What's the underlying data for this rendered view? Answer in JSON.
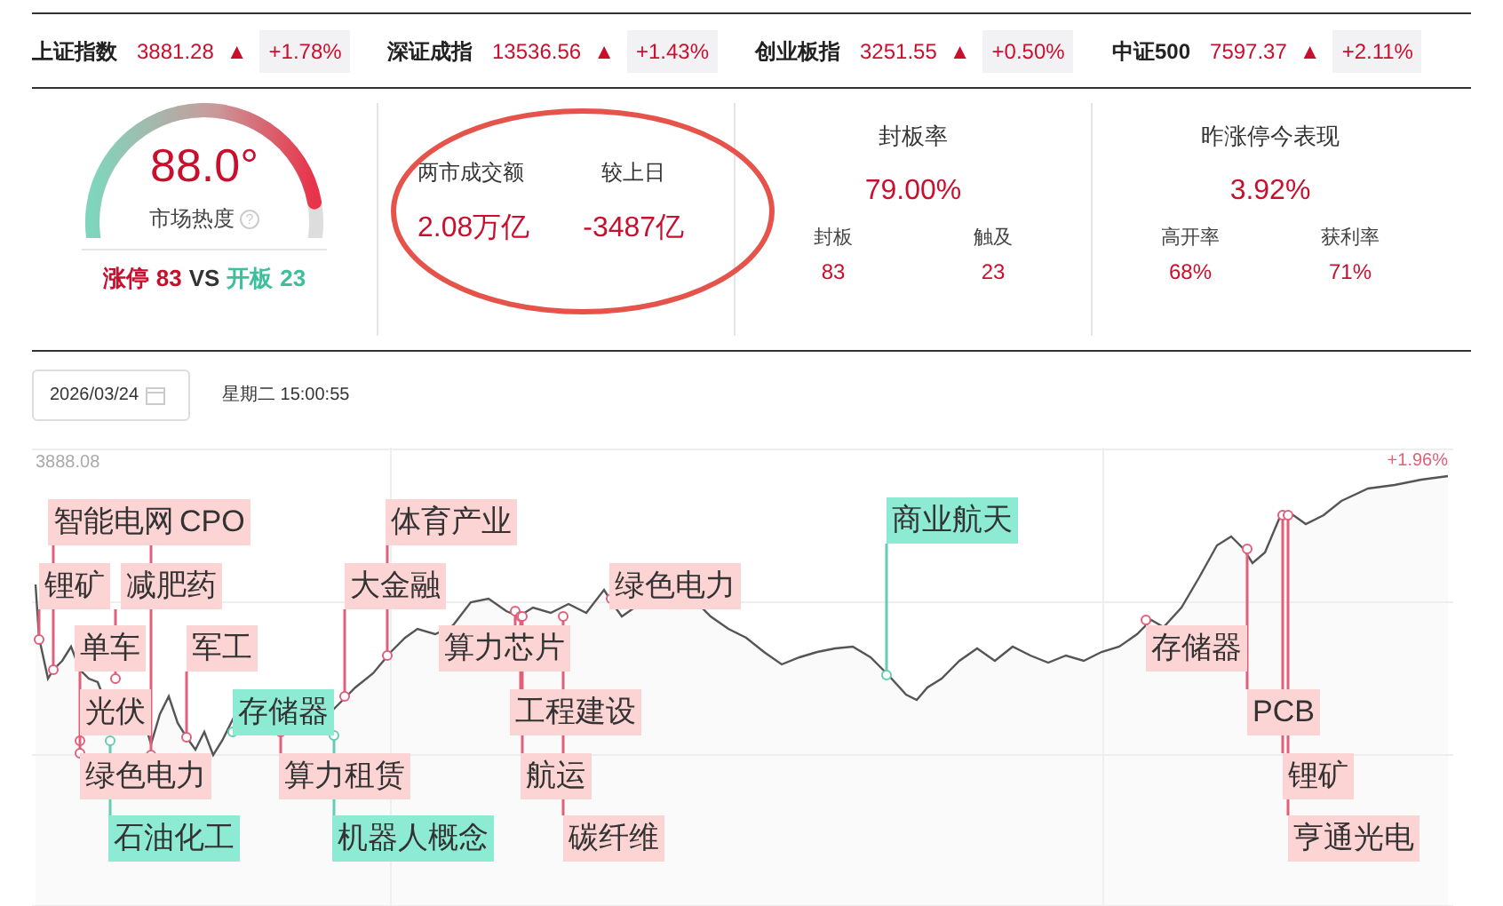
{
  "indices": [
    {
      "name": "上证指数",
      "value": "3881.28",
      "arrow": "▲",
      "change": "+1.78%"
    },
    {
      "name": "深证成指",
      "value": "13536.56",
      "arrow": "▲",
      "change": "+1.43%"
    },
    {
      "name": "创业板指",
      "value": "3251.55",
      "arrow": "▲",
      "change": "+0.50%"
    },
    {
      "name": "中证500",
      "value": "7597.37",
      "arrow": "▲",
      "change": "+2.11%"
    }
  ],
  "heat": {
    "value": "88.0°",
    "label": "市场热度",
    "help": "?",
    "limit_up_label": "涨停",
    "limit_up_count": "83",
    "vs": "VS",
    "open_label": "开板",
    "open_count": "23"
  },
  "turnover": {
    "columns": [
      {
        "label": "两市成交额",
        "value": "2.08万亿"
      },
      {
        "label": "较上日",
        "value": "-3487亿"
      }
    ]
  },
  "seal_rate": {
    "title": "封板率",
    "value": "79.00%",
    "stats": [
      {
        "label": "封板",
        "value": "83"
      },
      {
        "label": "触及",
        "value": "23"
      }
    ]
  },
  "yesterday": {
    "title": "昨涨停今表现",
    "value": "3.92%",
    "stats": [
      {
        "label": "高开率",
        "value": "68%"
      },
      {
        "label": "获利率",
        "value": "71%"
      }
    ]
  },
  "date": "2026/03/24",
  "weekday_time": "星期二 15:00:55",
  "chart": {
    "top_label": "3888.08",
    "change_label": "+1.96%",
    "tags": [
      {
        "text": "智能电网",
        "kind": "rise"
      },
      {
        "text": "CPO",
        "kind": "rise"
      },
      {
        "text": "体育产业",
        "kind": "rise"
      },
      {
        "text": "商业航天",
        "kind": "fall"
      },
      {
        "text": "锂矿",
        "kind": "rise"
      },
      {
        "text": "减肥药",
        "kind": "rise"
      },
      {
        "text": "大金融",
        "kind": "rise"
      },
      {
        "text": "绿色电力",
        "kind": "rise"
      },
      {
        "text": "单车",
        "kind": "rise"
      },
      {
        "text": "军工",
        "kind": "rise"
      },
      {
        "text": "算力芯片",
        "kind": "rise"
      },
      {
        "text": "存储器",
        "kind": "rise"
      },
      {
        "text": "光伏",
        "kind": "rise"
      },
      {
        "text": "存储器",
        "kind": "fall"
      },
      {
        "text": "工程建设",
        "kind": "rise"
      },
      {
        "text": "PCB",
        "kind": "rise"
      },
      {
        "text": "绿色电力",
        "kind": "rise"
      },
      {
        "text": "算力租赁",
        "kind": "rise"
      },
      {
        "text": "航运",
        "kind": "rise"
      },
      {
        "text": "锂矿",
        "kind": "rise"
      },
      {
        "text": "石油化工",
        "kind": "fall"
      },
      {
        "text": "机器人概念",
        "kind": "fall"
      },
      {
        "text": "碳纤维",
        "kind": "rise"
      },
      {
        "text": "亨通光电",
        "kind": "rise"
      }
    ]
  }
}
